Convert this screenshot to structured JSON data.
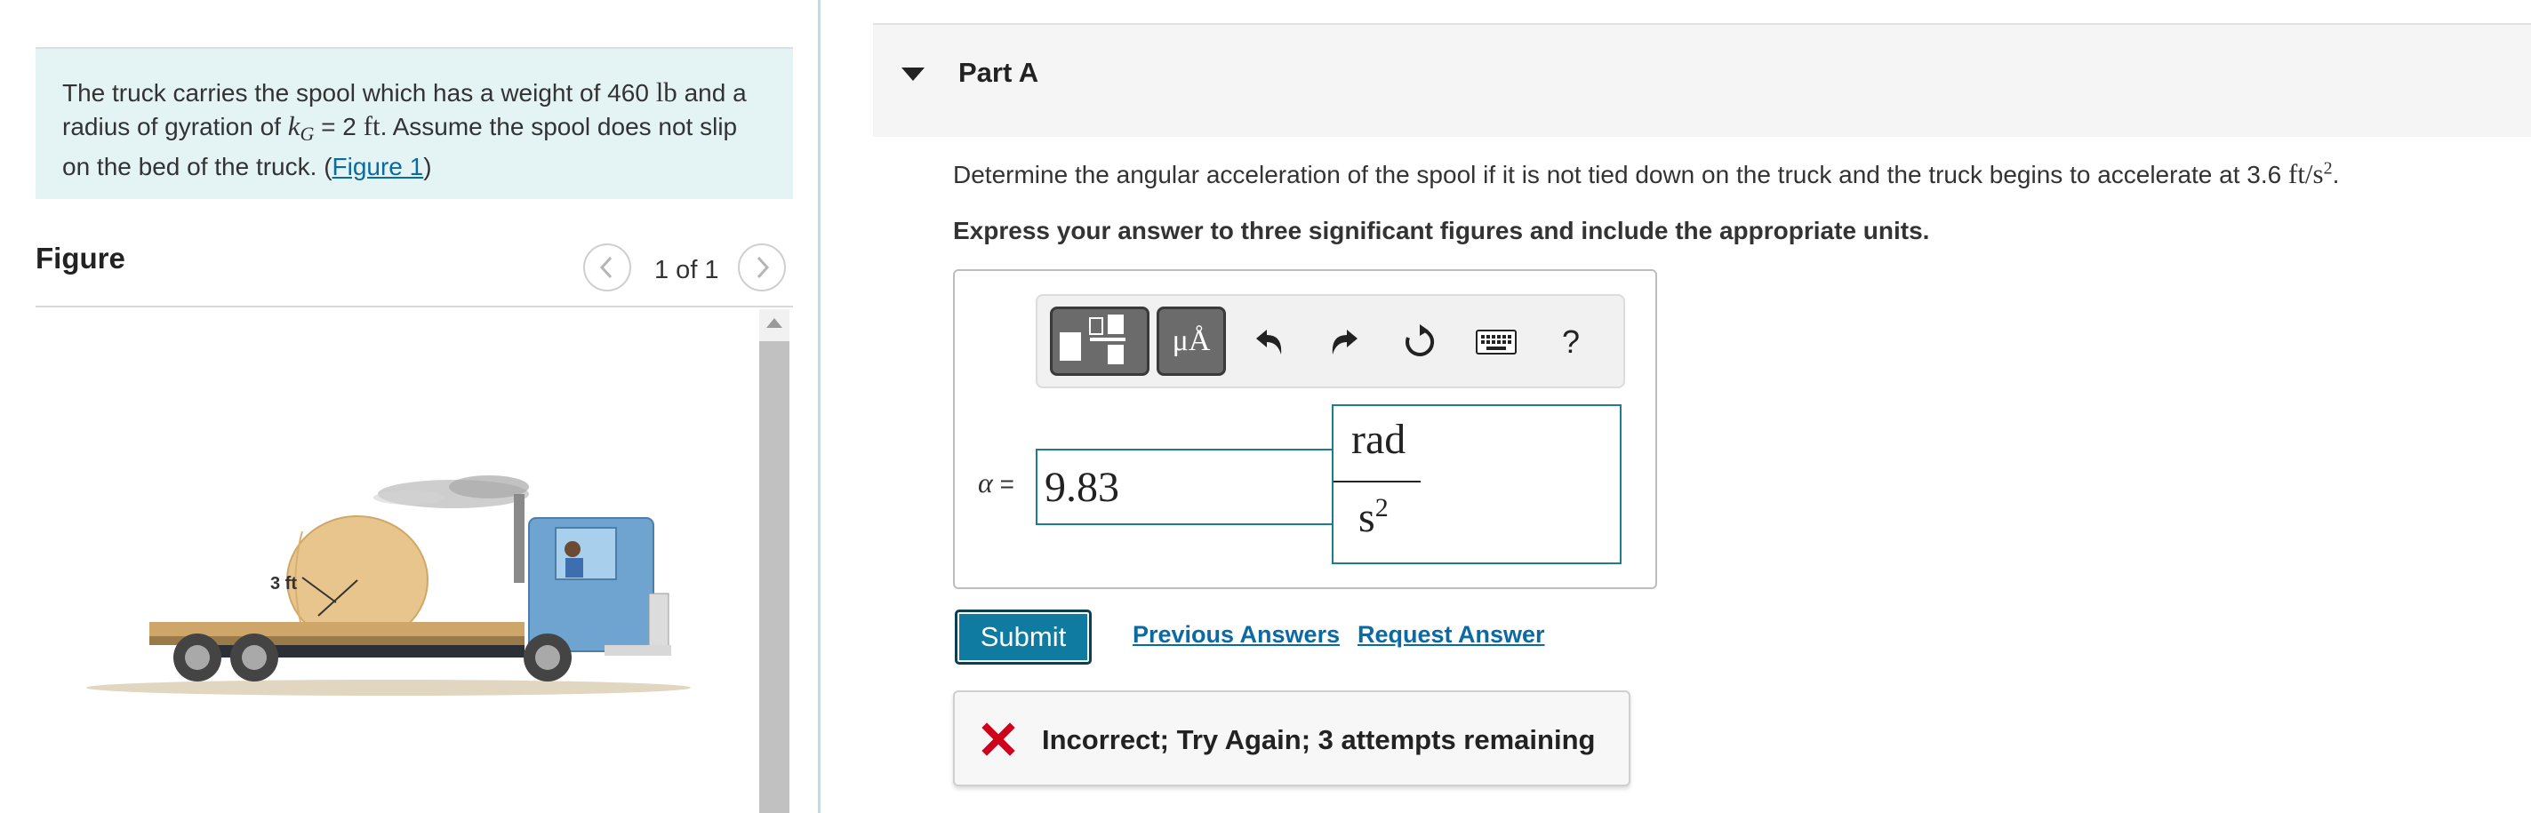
{
  "problem": {
    "text_1": "The truck carries the spool which has a weight of 460 ",
    "weight_unit": "lb",
    "text_2": " and a radius of gyration of ",
    "k_symbol": "k",
    "k_sub": "G",
    "text_3": " = 2 ",
    "length_unit": "ft",
    "text_4": ". Assume the spool does not slip on the bed of the truck. (",
    "figure_link": "Figure 1",
    "text_5": ")"
  },
  "figure": {
    "title": "Figure",
    "counter": "1 of 1",
    "prev_icon": "chevron-left-icon",
    "next_icon": "chevron-right-icon",
    "dimension_label": "3 ft"
  },
  "part": {
    "title": "Part A",
    "question_text": "Determine the angular acceleration of the spool if it is not tied down on the truck and the truck begins to accelerate at 3.6 ",
    "question_unit": "ft/s",
    "question_exp": "2",
    "question_end": ".",
    "instruction": "Express your answer to three significant figures and include the appropriate units."
  },
  "toolbar": {
    "units_label": "μÅ",
    "help_label": "?",
    "icons": [
      "templates-icon",
      "units-icon",
      "undo-icon",
      "redo-icon",
      "reset-icon",
      "keyboard-icon",
      "help-icon"
    ]
  },
  "answer": {
    "variable": "α",
    "equals": " =",
    "value": "9.83",
    "unit_numerator": "rad",
    "unit_denominator": "s",
    "unit_exp": "2"
  },
  "actions": {
    "submit": "Submit",
    "previous_answers": "Previous Answers",
    "request_answer": "Request Answer"
  },
  "feedback": {
    "icon": "x-icon",
    "text": "Incorrect; Try Again; 3 attempts remaining"
  },
  "colors": {
    "accent": "#0f7ba0",
    "link": "#0b6aa2",
    "error": "#d0021b",
    "problem_bg": "#e4f4f5"
  }
}
